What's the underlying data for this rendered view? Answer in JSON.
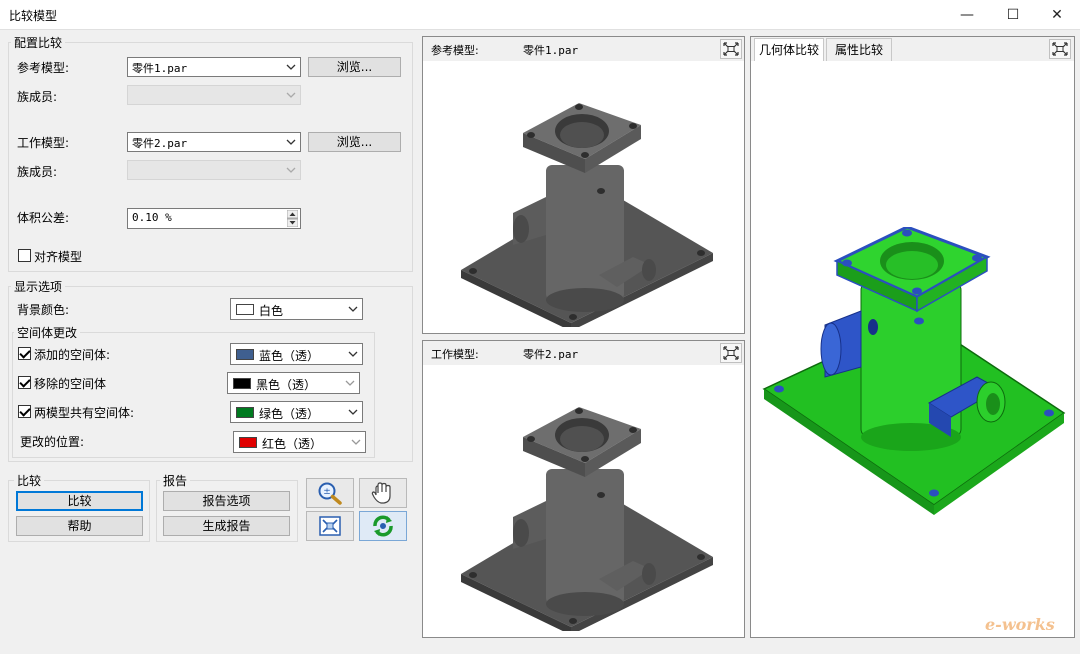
{
  "window": {
    "title": "比较模型",
    "minimize": "—",
    "maximize": "☐",
    "close": "✕"
  },
  "config": {
    "group_label": "配置比较",
    "ref_model_label": "参考模型:",
    "ref_model_value": "零件1.par",
    "browse_label": "浏览...",
    "family_label": "族成员:",
    "work_model_label": "工作模型:",
    "work_model_value": "零件2.par",
    "volume_tolerance_label": "体积公差:",
    "volume_tolerance_value": "0.10 %",
    "align_models_label": "对齐模型",
    "align_models_checked": false
  },
  "display": {
    "group_label": "显示选项",
    "bg_color_label": "背景颜色:",
    "bg_color_value": "白色",
    "bg_color_hex": "#ffffff",
    "space_changes_label": "空间体更改",
    "added_label": "添加的空间体:",
    "added_checked": true,
    "added_color": "蓝色（透）",
    "added_hex": "#3f5f8f",
    "removed_label": "移除的空间体",
    "removed_checked": true,
    "removed_color": "黑色（透）",
    "removed_hex": "#000000",
    "shared_label": "两模型共有空间体:",
    "shared_checked": true,
    "shared_color": "绿色（透）",
    "shared_hex": "#007a20",
    "changed_loc_label": "更改的位置:",
    "changed_color": "红色（透）",
    "changed_hex": "#e00000"
  },
  "compare": {
    "group_label": "比较",
    "compare_button": "比较",
    "help_button": "帮助"
  },
  "report": {
    "group_label": "报告",
    "options_button": "报告选项",
    "generate_button": "生成报告"
  },
  "toolbar": {
    "zoom_icon": "zoom-icon",
    "pan_icon": "pan-hand-icon",
    "fit_icon": "fit-view-icon",
    "rotate_icon": "rotate-icon"
  },
  "views": {
    "ref_header_label": "参考模型:",
    "ref_header_file": "零件1.par",
    "work_header_label": "工作模型:",
    "work_header_file": "零件2.par",
    "tab_geometry": "几何体比较",
    "tab_attributes": "属性比较",
    "model_gray": "#5a5a5a",
    "model_green": "#1fc01f",
    "model_blue": "#2e55c8"
  },
  "watermark": "e-works"
}
